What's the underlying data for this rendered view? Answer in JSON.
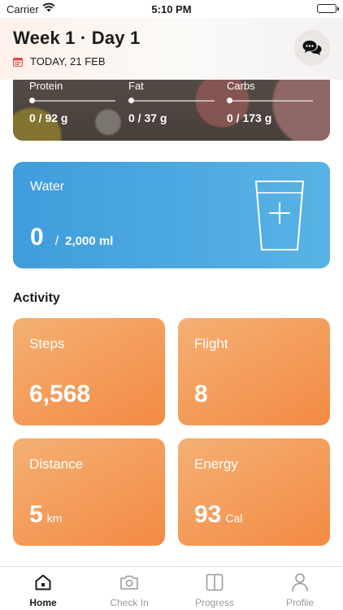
{
  "status_bar": {
    "carrier": "Carrier",
    "time": "5:10 PM"
  },
  "header": {
    "title": "Week 1 · Day 1",
    "date": "TODAY, 21 FEB"
  },
  "macros": [
    {
      "label": "Protein",
      "value": "0 / 92 g",
      "progress": 0
    },
    {
      "label": "Fat",
      "value": "0 / 37 g",
      "progress": 0
    },
    {
      "label": "Carbs",
      "value": "0 / 173 g",
      "progress": 0
    }
  ],
  "water": {
    "label": "Water",
    "value": "0",
    "separator": "/",
    "goal": "2,000 ml",
    "icon": "glass-plus-icon"
  },
  "activity": {
    "title": "Activity",
    "tiles": [
      {
        "label": "Steps",
        "value": "6,568",
        "unit": ""
      },
      {
        "label": "Flight",
        "value": "8",
        "unit": ""
      },
      {
        "label": "Distance",
        "value": "5",
        "unit": "km"
      },
      {
        "label": "Energy",
        "value": "93",
        "unit": "Cal"
      }
    ]
  },
  "tabs": [
    {
      "label": "Home",
      "icon": "home-icon",
      "active": true
    },
    {
      "label": "Check In",
      "icon": "camera-icon",
      "active": false
    },
    {
      "label": "Progress",
      "icon": "progress-icon",
      "active": false
    },
    {
      "label": "Profile",
      "icon": "person-icon",
      "active": false
    }
  ],
  "colors": {
    "water": "#4aa8e0",
    "activity": "#f39a55",
    "calendar": "#e5483b"
  }
}
